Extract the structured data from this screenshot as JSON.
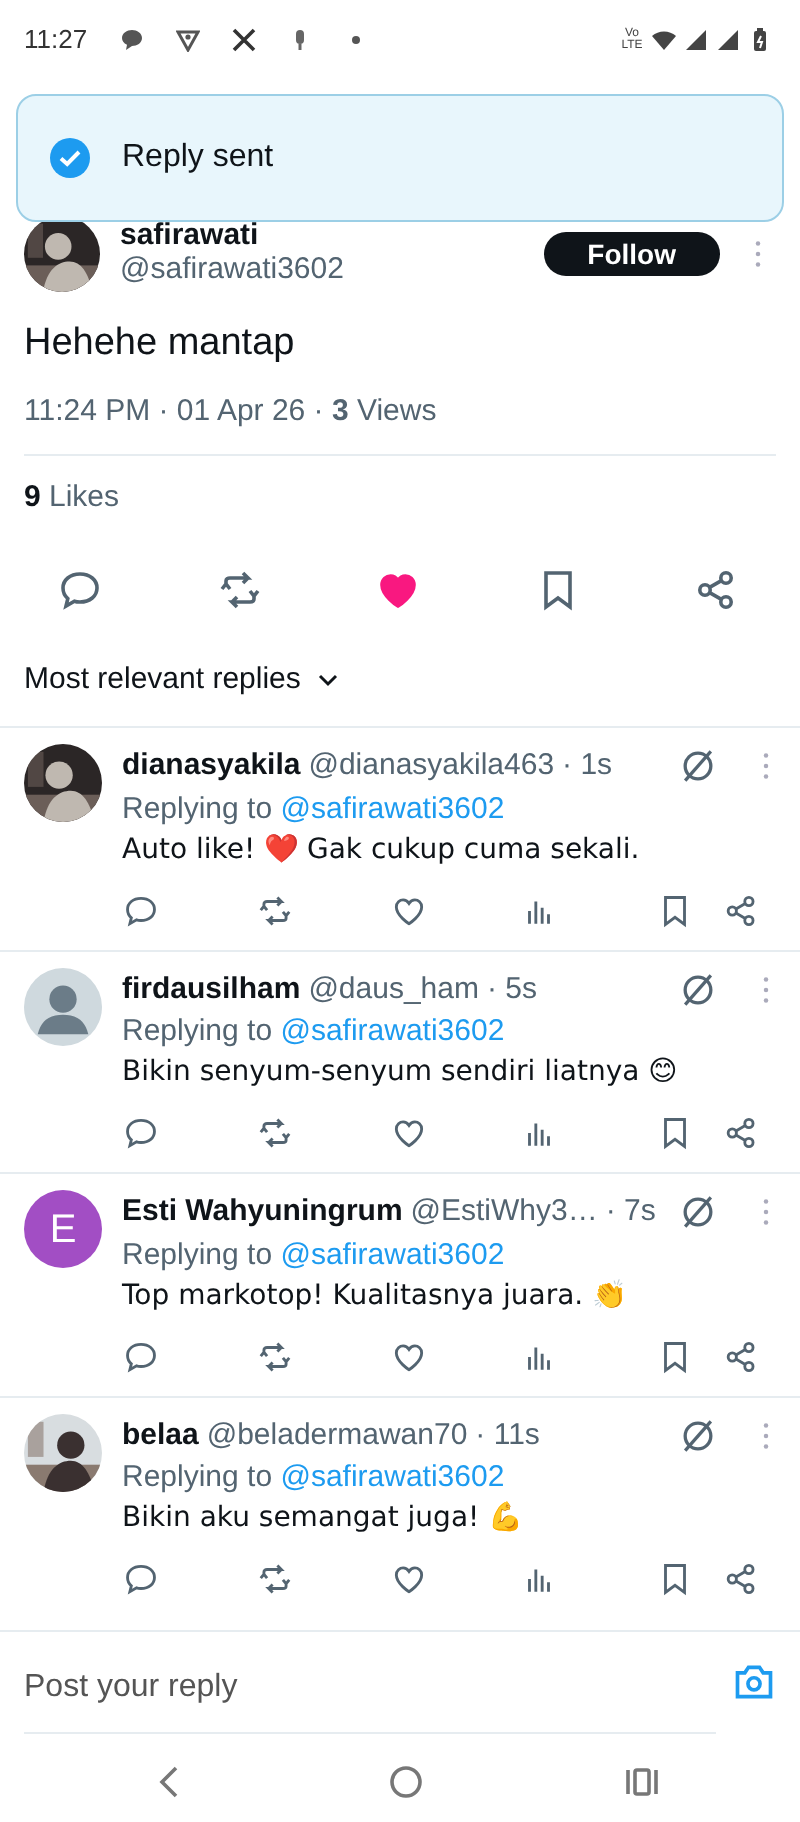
{
  "status_bar": {
    "time": "11:27",
    "network_label": "Vo LTE"
  },
  "toast": {
    "text": "Reply sent"
  },
  "post": {
    "author_name": "safirawati",
    "handle": "@safirawati3602",
    "follow_button": "Follow",
    "text": "Hehehe mantap",
    "meta": "11:24 PM · 01 Apr 26 · **3** Views",
    "likes": "**9** Likes",
    "liked": true
  },
  "sort": {
    "label": "Most relevant replies"
  },
  "replies": [
    {
      "name": "dianasyakila",
      "handle": "@dianasyakila463",
      "age": "· 1s",
      "replying_label": "Replying to",
      "replying_to": "@safirawati3602",
      "text": "Auto like! ❤️ Gak cukup cuma sekali."
    },
    {
      "avatar": {
        "kind": "default"
      },
      "name": "firdausilham",
      "handle": "@daus_ham",
      "age": "· 5s",
      "replying_label": "Replying to",
      "replying_to": "@safirawati3602",
      "text": "Bikin senyum-senyum sendiri liatnya 😊"
    },
    {
      "avatar": {
        "kind": "letter",
        "letter": "E",
        "color": "#a24ec4"
      },
      "name": "Esti Wahyuningrum",
      "handle": "@EstiWhy3…",
      "age": "· 7s",
      "replying_label": "Replying to",
      "replying_to": "@safirawati3602",
      "text": "Top markotop! Kualitasnya juara. 👏"
    },
    {
      "name": "belaa",
      "handle": "@beladermawan70",
      "age": "· 11s",
      "replying_label": "Replying to",
      "replying_to": "@safirawati3602",
      "text": "Bikin aku semangat juga! 💪"
    }
  ],
  "reply_box": {
    "placeholder": "Post your reply"
  }
}
